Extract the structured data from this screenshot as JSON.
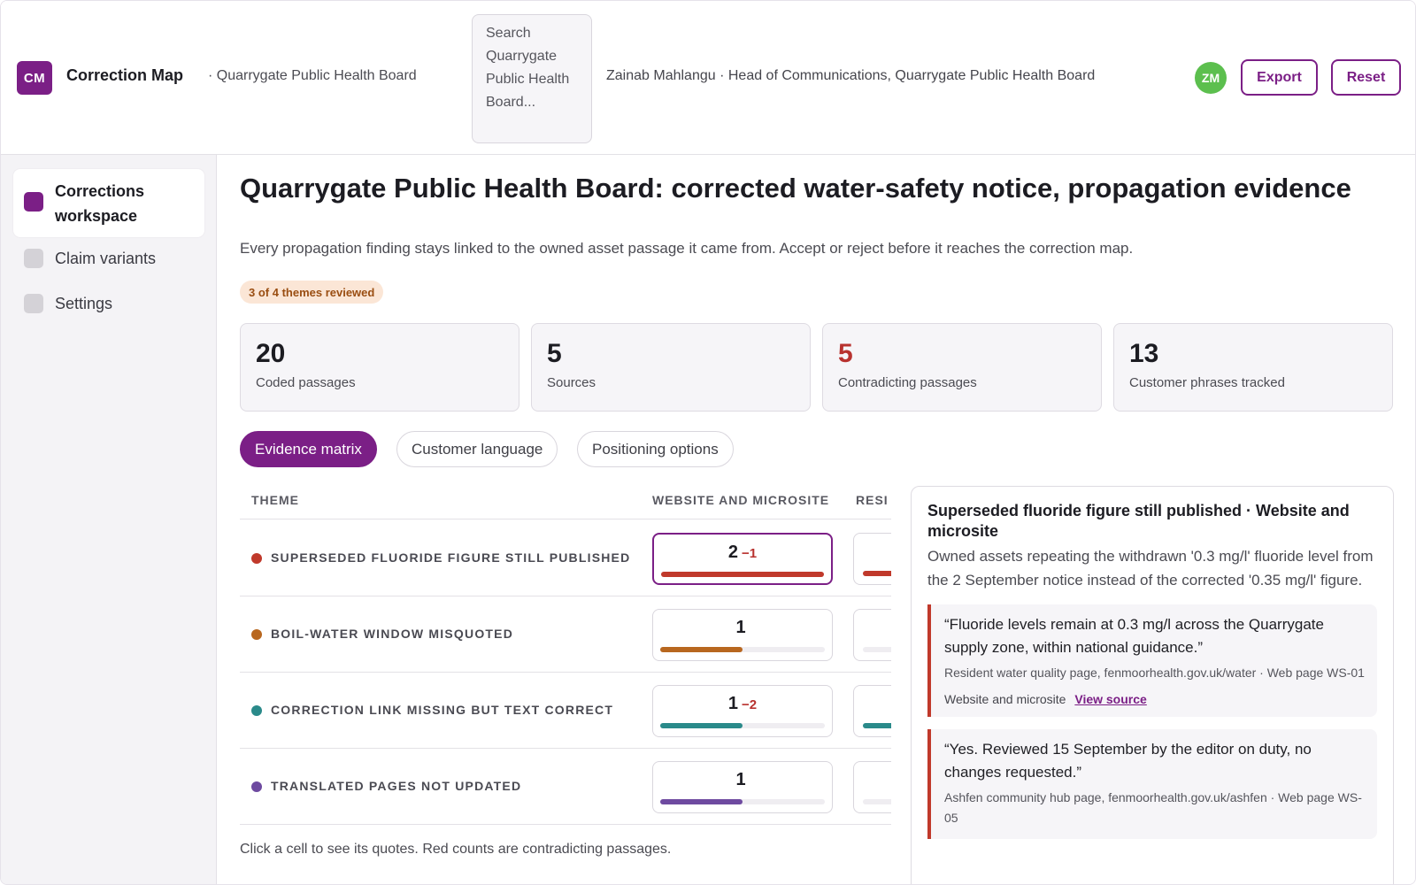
{
  "app": {
    "logo_text": "CM",
    "title": "Correction Map",
    "org_crumb": "· Quarrygate Public Health Board"
  },
  "search": {
    "placeholder": "Search Quarrygate Public Health Board..."
  },
  "user": {
    "line": "Zainab Mahlangu · Head of Communications, Quarrygate Public Health Board",
    "initials": "ZM",
    "avatar_color": "#5cbf4e"
  },
  "actions": {
    "export_label": "Export",
    "reset_label": "Reset"
  },
  "sidebar": {
    "items": [
      {
        "label": "Corrections workspace",
        "active": true
      },
      {
        "label": "Claim variants",
        "active": false
      },
      {
        "label": "Settings",
        "active": false
      }
    ]
  },
  "page": {
    "title": "Quarrygate Public Health Board: corrected water-safety notice, propagation evidence",
    "subtitle": "Every propagation finding stays linked to the owned asset passage it came from. Accept or reject before it reaches the correction map.",
    "review_badge": "3 of 4 themes reviewed"
  },
  "stats": [
    {
      "value": "20",
      "label": "Coded passages"
    },
    {
      "value": "5",
      "label": "Sources"
    },
    {
      "value": "5",
      "label": "Contradicting passages",
      "alert": true
    },
    {
      "value": "13",
      "label": "Customer phrases tracked"
    }
  ],
  "tabs": [
    {
      "label": "Evidence matrix",
      "active": true
    },
    {
      "label": "Customer language",
      "active": false
    },
    {
      "label": "Positioning options",
      "active": false
    }
  ],
  "matrix": {
    "columns": [
      "THEME",
      "WEBSITE AND MICROSITE",
      "RESI"
    ],
    "rows": [
      {
        "theme": "SUPERSEDED FLUORIDE FIGURE STILL PUBLISHED",
        "color": "#c0392b",
        "count": "2",
        "contradict": "−1",
        "fill": 1.0,
        "next_fill": 0.5,
        "selected": true
      },
      {
        "theme": "BOIL-WATER WINDOW MISQUOTED",
        "color": "#b8671f",
        "count": "1",
        "contradict": "",
        "fill": 0.5,
        "next_fill": 0.0,
        "selected": false
      },
      {
        "theme": "CORRECTION LINK MISSING BUT TEXT CORRECT",
        "color": "#2a8a8a",
        "count": "1",
        "contradict": "−2",
        "fill": 0.5,
        "next_fill": 0.5,
        "selected": false
      },
      {
        "theme": "TRANSLATED PAGES NOT UPDATED",
        "color": "#6e4aa0",
        "count": "1",
        "contradict": "",
        "fill": 0.5,
        "next_fill": 0.0,
        "selected": false
      }
    ],
    "hint": "Click a cell to see its quotes. Red counts are contradicting passages."
  },
  "detail": {
    "title": "Superseded fluoride figure still published · Website and microsite",
    "description": "Owned assets repeating the withdrawn '0.3 mg/l' fluoride level from the 2 September notice instead of the corrected '0.35 mg/l' figure.",
    "quotes": [
      {
        "text": "“Fluoride levels remain at 0.3 mg/l across the Quarrygate supply zone, within national guidance.”",
        "source": "Resident water quality page, fenmoorhealth.gov.uk/water · Web page WS-01",
        "channel": "Website and microsite",
        "link_label": "View source"
      },
      {
        "text": "“Yes. Reviewed 15 September by the editor on duty, no changes requested.”",
        "source": "Ashfen community hub page, fenmoorhealth.gov.uk/ashfen · Web page WS-05"
      }
    ]
  }
}
